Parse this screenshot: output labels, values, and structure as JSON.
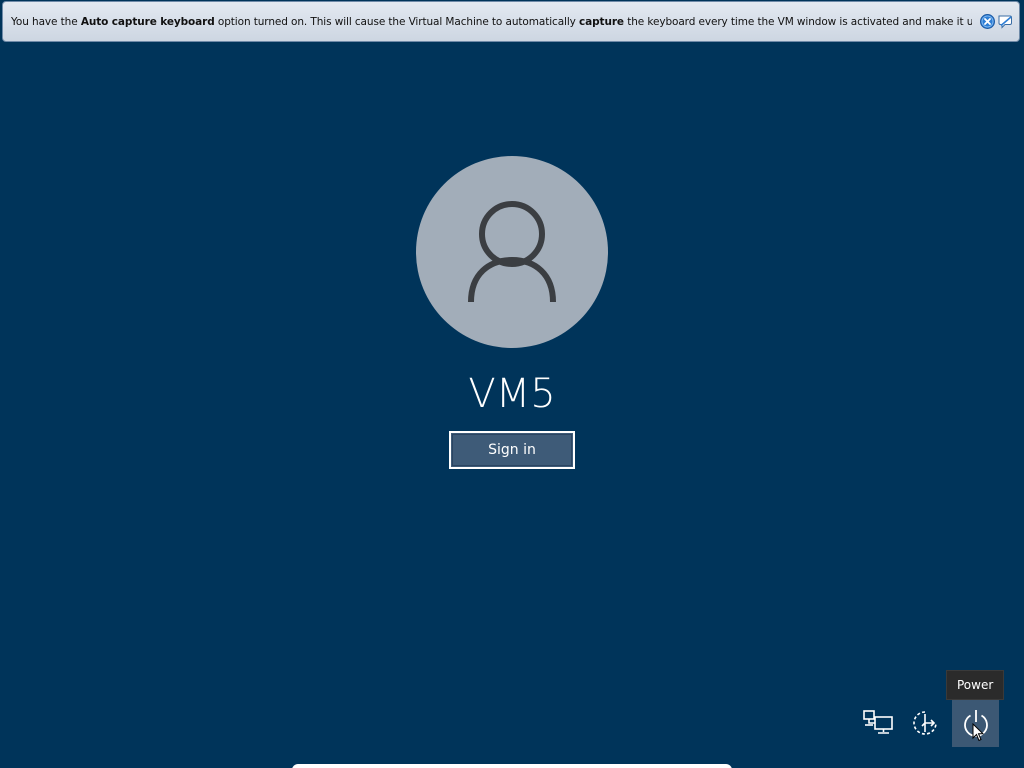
{
  "notification": {
    "text_part1": "You have the ",
    "bold1": "Auto capture keyboard",
    "text_part2": " option turned on. This will cause the Virtual Machine to automatically ",
    "bold2": "capture",
    "text_part3": " the keyboard every time the VM window is activated and make it unavailable to",
    "icons": [
      "close-icon",
      "dont-show-again-icon"
    ],
    "close_color": "#2f7fd6"
  },
  "lock_screen": {
    "user_name": "VM5",
    "sign_in_label": "Sign in"
  },
  "tray": {
    "icons": [
      "network-icon",
      "ease-of-access-icon",
      "power-icon"
    ],
    "power_tooltip": "Power"
  },
  "colors": {
    "background": "#00345a",
    "avatar": "#a2adb9",
    "button_fill": "#3e5b78",
    "tooltip": "#2b2b2b"
  }
}
